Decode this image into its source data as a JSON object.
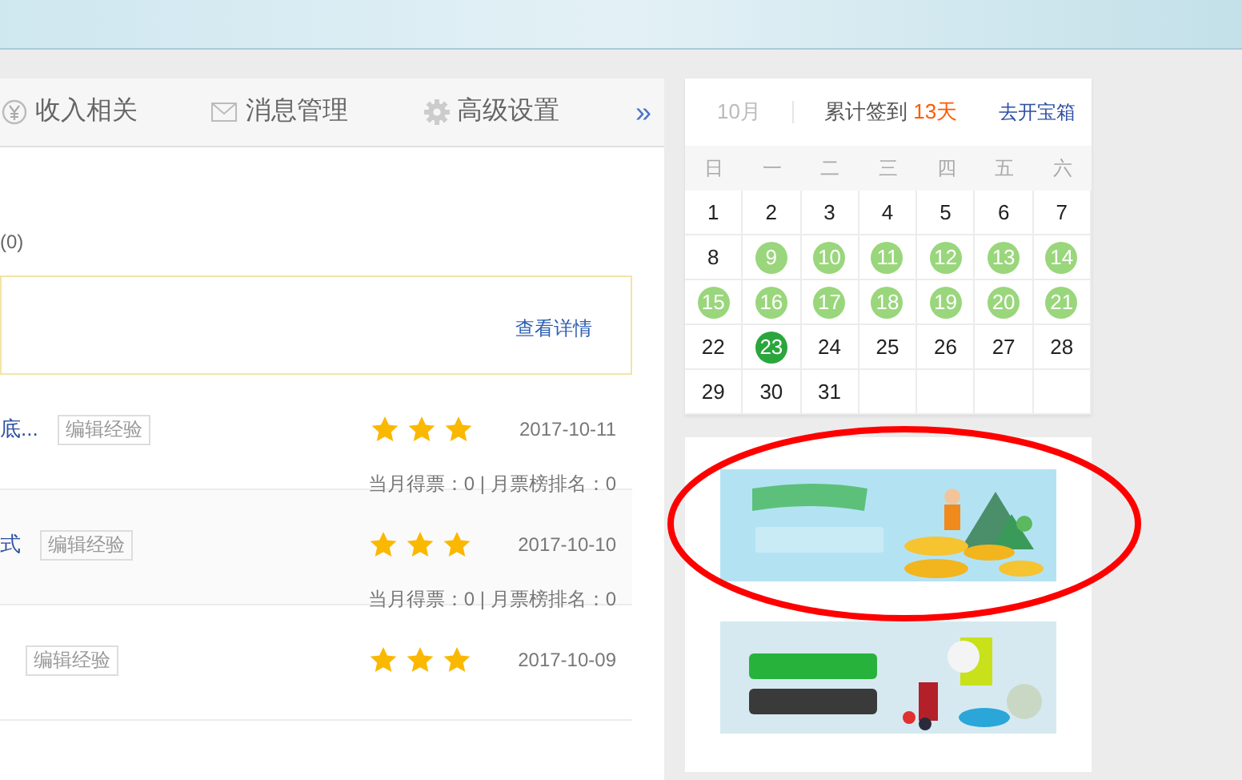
{
  "tabs": [
    {
      "label": "收入相关"
    },
    {
      "label": "消息管理"
    },
    {
      "label": "高级设置"
    }
  ],
  "more_button": "»",
  "count": "(0)",
  "notice": {
    "link": "查看详情"
  },
  "experiences": [
    {
      "title": "底...",
      "tag": "编辑经验",
      "stars": 3,
      "date": "2017-10-11",
      "stats": "当月得票：0 | 月票榜排名：0"
    },
    {
      "title": "式",
      "tag": "编辑经验",
      "stars": 3,
      "date": "2017-10-10",
      "stats": "当月得票：0 | 月票榜排名：0"
    },
    {
      "tag": "编辑经验",
      "stars": 3,
      "date": "2017-10-09"
    }
  ],
  "calendar": {
    "month": "10月",
    "summary_label": "累计签到",
    "summary_value": "13天",
    "link": "去开宝箱",
    "weekdays": [
      "日",
      "一",
      "二",
      "三",
      "四",
      "五",
      "六"
    ],
    "days": [
      {
        "day": "1",
        "signed": false,
        "today": false
      },
      {
        "day": "2",
        "signed": false,
        "today": false
      },
      {
        "day": "3",
        "signed": false,
        "today": false
      },
      {
        "day": "4",
        "signed": false,
        "today": false
      },
      {
        "day": "5",
        "signed": false,
        "today": false
      },
      {
        "day": "6",
        "signed": false,
        "today": false
      },
      {
        "day": "7",
        "signed": false,
        "today": false
      },
      {
        "day": "8",
        "signed": false,
        "today": false
      },
      {
        "day": "9",
        "signed": true,
        "today": false
      },
      {
        "day": "10",
        "signed": true,
        "today": false
      },
      {
        "day": "11",
        "signed": true,
        "today": false
      },
      {
        "day": "12",
        "signed": true,
        "today": false
      },
      {
        "day": "13",
        "signed": true,
        "today": false
      },
      {
        "day": "14",
        "signed": true,
        "today": false
      },
      {
        "day": "15",
        "signed": true,
        "today": false
      },
      {
        "day": "16",
        "signed": true,
        "today": false
      },
      {
        "day": "17",
        "signed": true,
        "today": false
      },
      {
        "day": "18",
        "signed": true,
        "today": false
      },
      {
        "day": "19",
        "signed": true,
        "today": false
      },
      {
        "day": "20",
        "signed": true,
        "today": false
      },
      {
        "day": "21",
        "signed": true,
        "today": false
      },
      {
        "day": "22",
        "signed": false,
        "today": false
      },
      {
        "day": "23",
        "signed": false,
        "today": true
      },
      {
        "day": "24",
        "signed": false,
        "today": false
      },
      {
        "day": "25",
        "signed": false,
        "today": false
      },
      {
        "day": "26",
        "signed": false,
        "today": false
      },
      {
        "day": "27",
        "signed": false,
        "today": false
      },
      {
        "day": "28",
        "signed": false,
        "today": false
      },
      {
        "day": "29",
        "signed": false,
        "today": false
      },
      {
        "day": "30",
        "signed": false,
        "today": false
      },
      {
        "day": "31",
        "signed": false,
        "today": false
      }
    ]
  },
  "annotation": {
    "kind": "ellipse"
  }
}
